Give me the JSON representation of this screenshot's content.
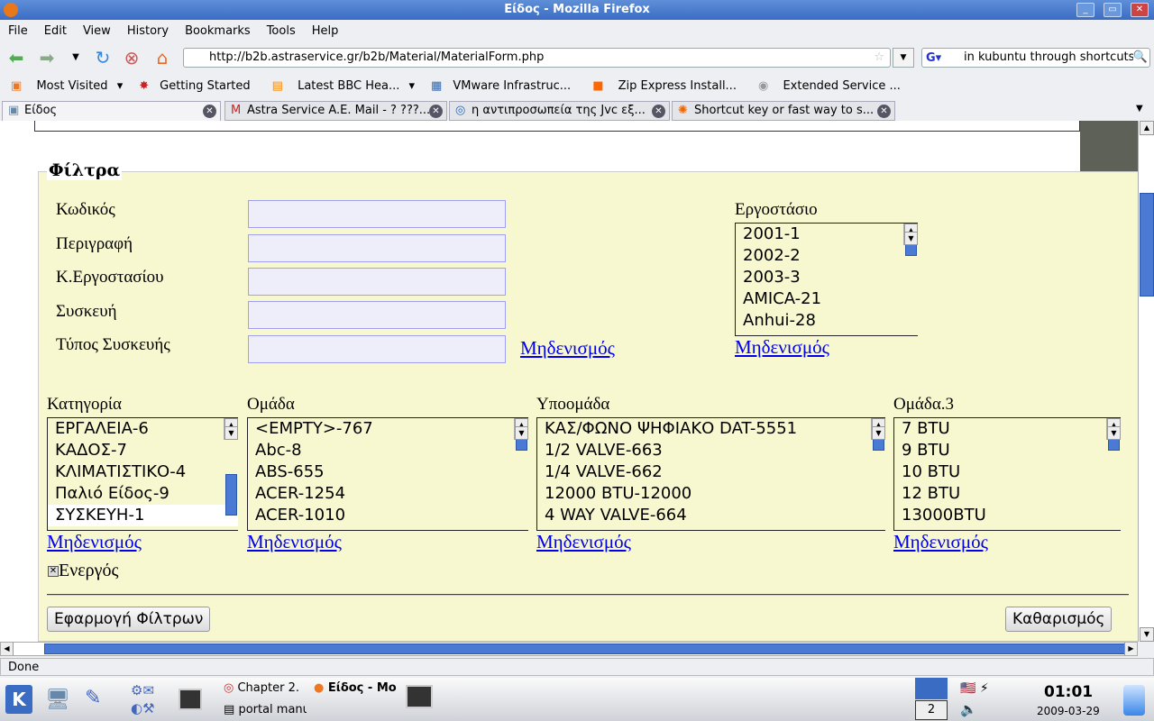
{
  "window": {
    "title": "Είδος - Mozilla Firefox"
  },
  "menu": [
    "File",
    "Edit",
    "View",
    "History",
    "Bookmarks",
    "Tools",
    "Help"
  ],
  "nav": {
    "url": "http://b2b.astraservice.gr/b2b/Material/MaterialForm.php",
    "search": "in kubuntu through shortcuts"
  },
  "bookmarks": [
    "Most Visited",
    "Getting Started",
    "Latest BBC Hea...",
    "VMware Infrastruc...",
    "Zip Express Install...",
    "Extended Service ..."
  ],
  "tabs": [
    "Είδος",
    "Astra Service A.E. Mail - ? ???...",
    "η αντιπροσωπεία της Jvc εξ...",
    "Shortcut key or fast way to s..."
  ],
  "form": {
    "legend": "Φίλτρα",
    "fields": [
      "Κωδικός",
      "Περιγραφή",
      "Κ.Εργοστασίου",
      "Συσκευή",
      "Τύπος Συσκευής"
    ],
    "reset": "Μηδενισμός",
    "factory": {
      "label": "Εργοστάσιο",
      "items": [
        "2001-1",
        "2002-2",
        "2003-3",
        "AMICA-21",
        "Anhui-28"
      ]
    },
    "lists": [
      {
        "label": "Κατηγορία",
        "items": [
          "ΕΡΓΑΛΕΙΑ-6",
          "ΚΑΔΟΣ-7",
          "ΚΛΙΜΑΤΙΣΤΙΚΟ-4",
          "Παλιό Είδος-9",
          "ΣΥΣΚΕΥΗ-1"
        ],
        "selected": "ΣΥΣΚΕΥΗ-1"
      },
      {
        "label": "Ομάδα",
        "items": [
          "<EMPTY>-767",
          "Abc-8",
          "ABS-655",
          "ACER-1254",
          "ACER-1010"
        ]
      },
      {
        "label": "Υποομάδα",
        "items": [
          "ΚΑΣ/ΦΩΝΟ ΨΗΦΙΑΚΟ DAT-5551",
          "1/2 VALVE-663",
          "1/4 VALVE-662",
          "12000 BTU-12000",
          "4 WAY VALVE-664"
        ]
      },
      {
        "label": "Ομάδα.3",
        "items": [
          "7 BTU",
          "9 BTU",
          "10 BTU",
          "12 BTU",
          "13000BTU"
        ]
      }
    ],
    "active": {
      "label": "Ενεργός",
      "checked": true
    },
    "apply": "Εφαρμογή Φίλτρων",
    "clear": "Καθαρισμός"
  },
  "status": "Done",
  "taskbar": {
    "tasks": [
      "Chapter 2.",
      "Είδος - Mo:",
      "portal manu"
    ],
    "desktop": "2",
    "time": "01:01",
    "date": "2009-03-29"
  }
}
